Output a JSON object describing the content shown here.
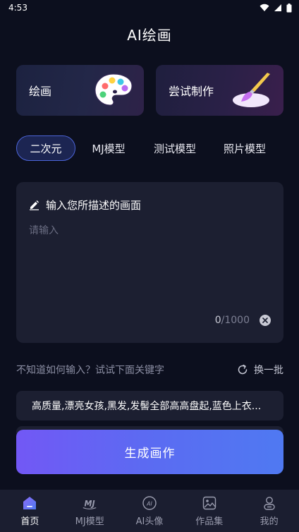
{
  "status_bar": {
    "time": "4:53"
  },
  "header": {
    "title": "AI绘画"
  },
  "cards": [
    {
      "label": "绘画",
      "icon": "palette-icon"
    },
    {
      "label": "尝试制作",
      "icon": "paintbrush-icon"
    }
  ],
  "model_tabs": {
    "items": [
      "二次元",
      "MJ模型",
      "测试模型",
      "照片模型"
    ],
    "active": "二次元"
  },
  "prompt": {
    "header": "输入您所描述的画面",
    "placeholder": "请输入",
    "value": "",
    "count": "0",
    "max": "/1000"
  },
  "hint": {
    "text": "不知道如何输入？试试下面关键字",
    "refresh_label": "换一批"
  },
  "keywords": [
    "高质量,漂亮女孩,黑发,发髻全部高高盘起,蓝色上衣..."
  ],
  "generate_button": "生成画作",
  "bottom_nav": {
    "items": [
      {
        "label": "首页",
        "icon": "home-icon",
        "active": true
      },
      {
        "label": "MJ模型",
        "icon": "mj-icon",
        "active": false
      },
      {
        "label": "AI头像",
        "icon": "ai-avatar-icon",
        "active": false
      },
      {
        "label": "作品集",
        "icon": "gallery-icon",
        "active": false
      },
      {
        "label": "我的",
        "icon": "profile-icon",
        "active": false
      }
    ]
  },
  "colors": {
    "background": "#0c0f1e",
    "card": "#1c1f31",
    "accent": "#4c64d8",
    "button_gradient_start": "#7258f5",
    "button_gradient_end": "#4f79f2"
  }
}
